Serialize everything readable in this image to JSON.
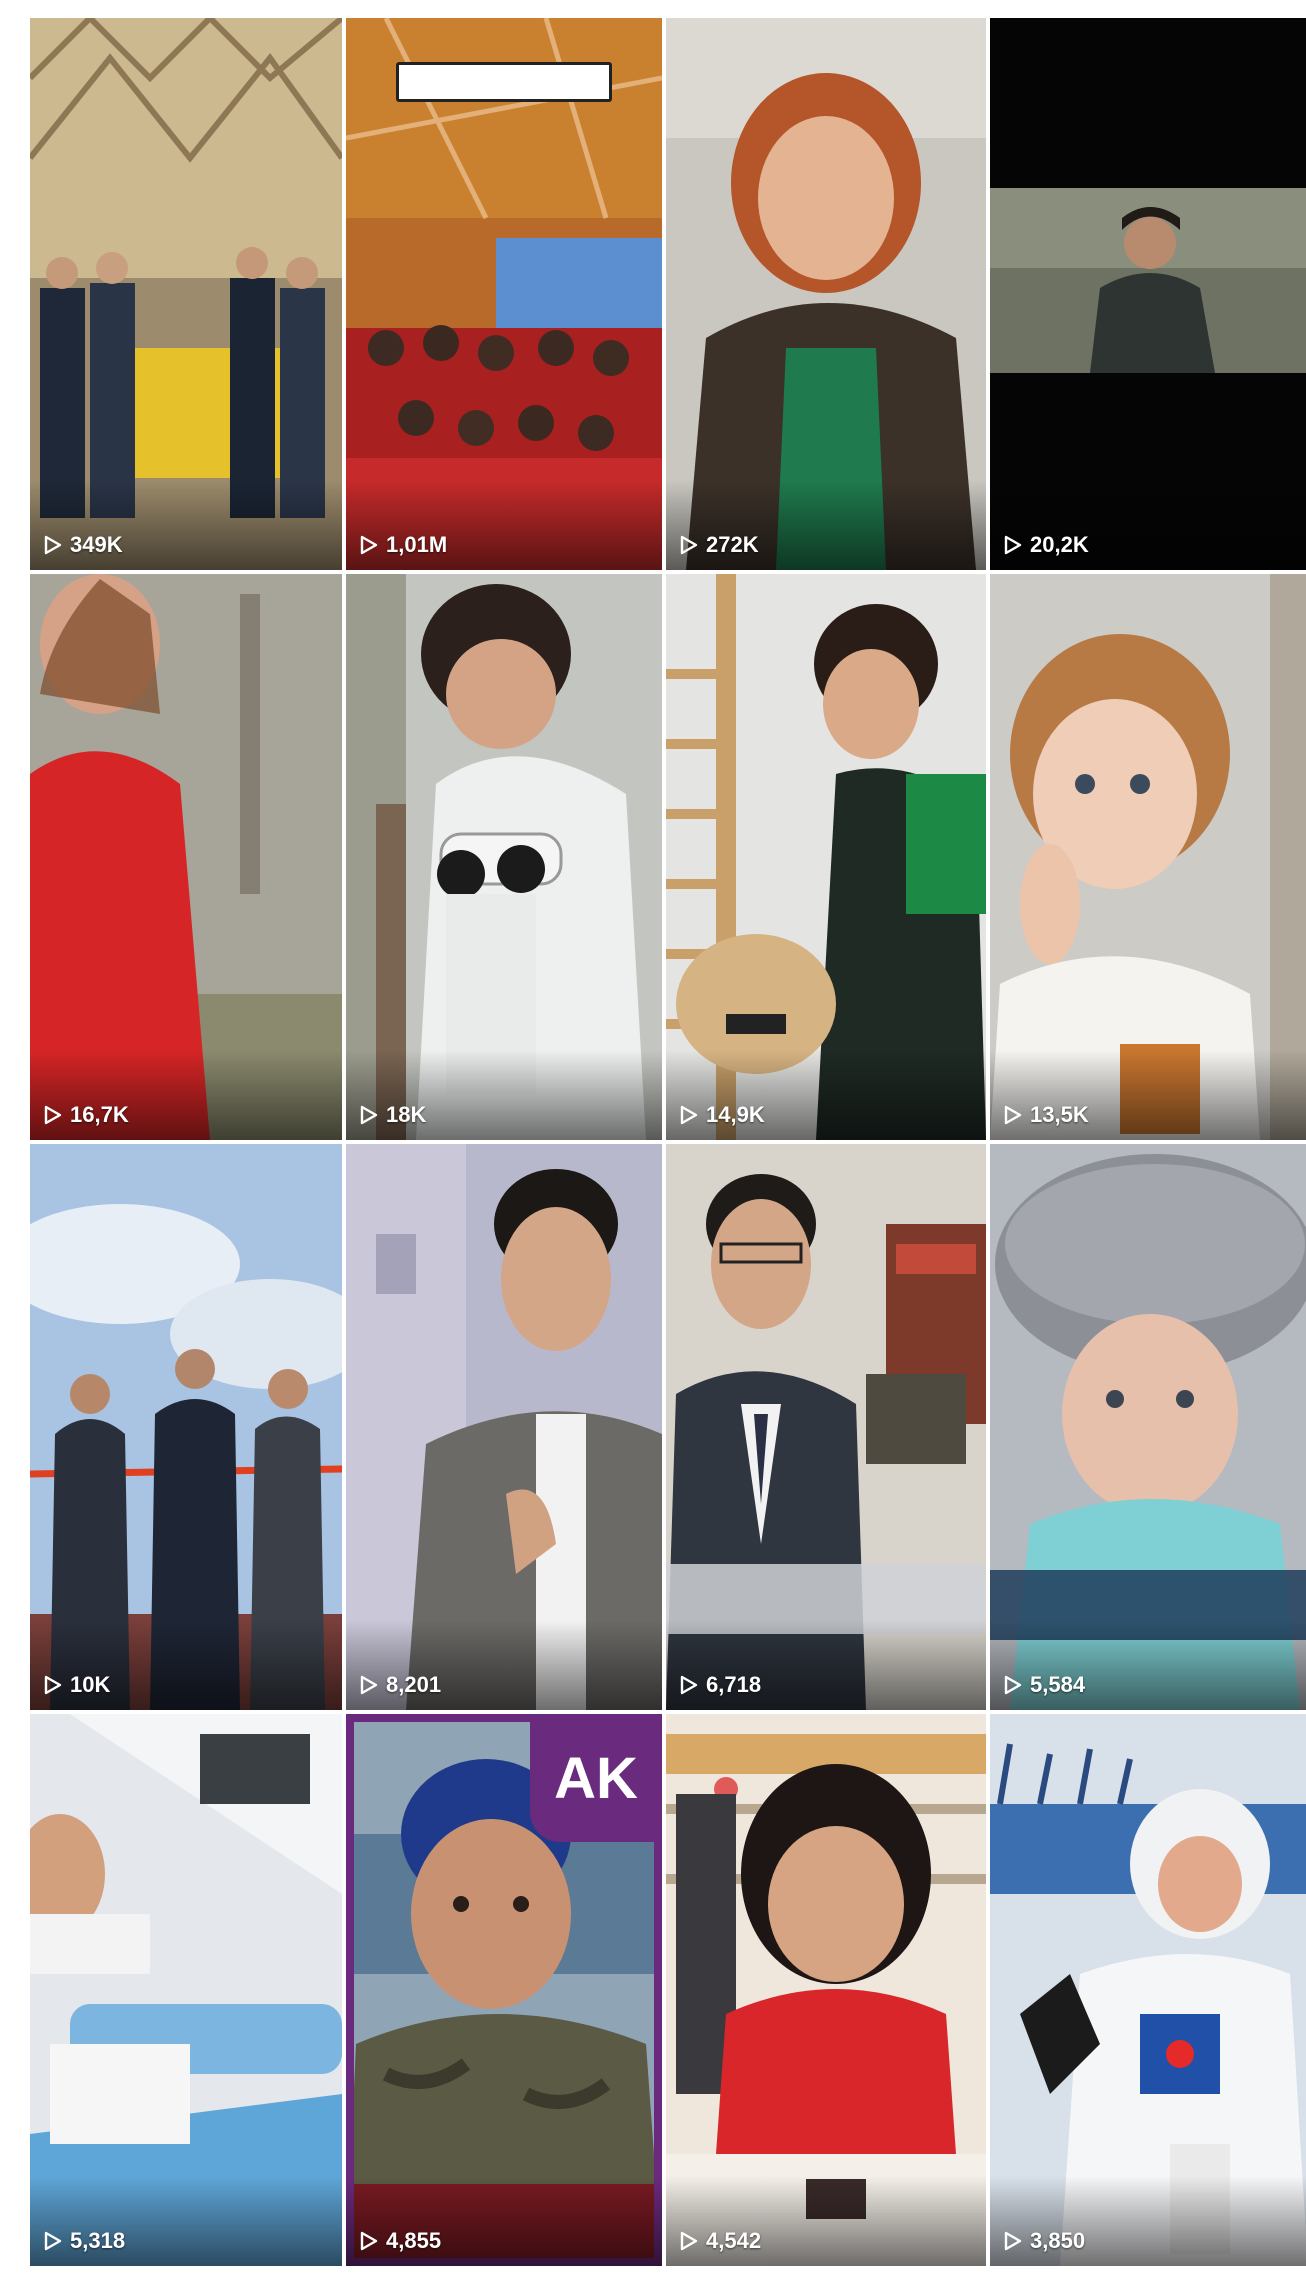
{
  "accent_color": "#6a2a7e",
  "play_icon": "play-outline-icon",
  "videos": [
    {
      "views": "349K"
    },
    {
      "views": "1,01M"
    },
    {
      "views": "272K"
    },
    {
      "views": "20,2K"
    },
    {
      "views": "16,7K"
    },
    {
      "views": "18K"
    },
    {
      "views": "14,9K"
    },
    {
      "views": "13,5K"
    },
    {
      "views": "10K"
    },
    {
      "views": "8,201"
    },
    {
      "views": "6,718"
    },
    {
      "views": "5,584"
    },
    {
      "views": "5,318"
    },
    {
      "views": "4,855",
      "badge": "AK"
    },
    {
      "views": "4,542"
    },
    {
      "views": "3,850"
    }
  ]
}
